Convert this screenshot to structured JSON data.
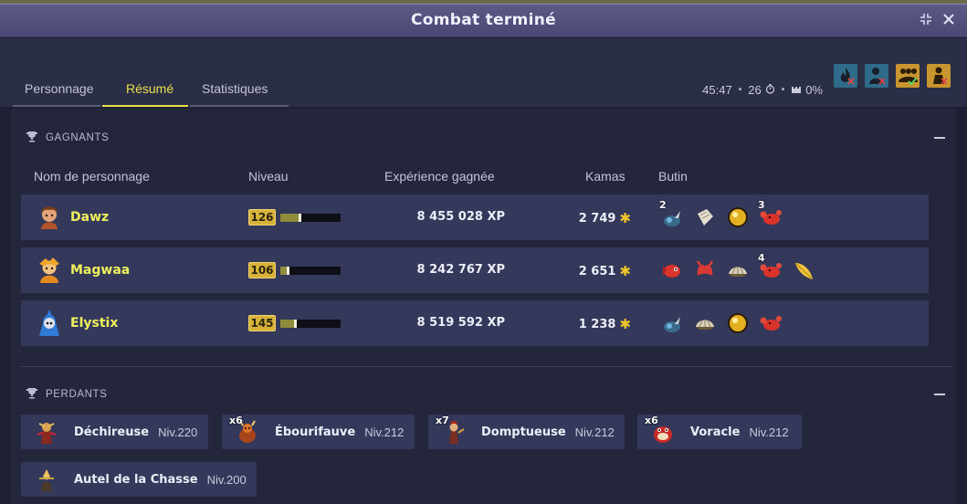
{
  "window": {
    "title": "Combat terminé",
    "restore_icon": "restore-icon",
    "close_icon": "close-icon"
  },
  "tabs": [
    {
      "label": "Personnage",
      "active": false
    },
    {
      "label": "Résumé",
      "active": true
    },
    {
      "label": "Statistiques",
      "active": false
    }
  ],
  "fight_info": {
    "duration": "45:47",
    "turns": "26",
    "separator": "•",
    "progress": "0%"
  },
  "state_icons": [
    "dark-flame-crossed-icon",
    "silhouette-crossed-icon",
    "group-checked-icon",
    "fighter-crossed-icon"
  ],
  "winners": {
    "title": "GAGNANTS",
    "columns": {
      "name": "Nom de personnage",
      "level": "Niveau",
      "xp": "Expérience gagnée",
      "kamas": "Kamas",
      "loot": "Butin"
    },
    "rows": [
      {
        "name": "Dawz",
        "level": "126",
        "level_progress": 0.3,
        "xp": "8 455 028 XP",
        "kamas": "2 749",
        "loot": [
          {
            "icon": "bird-tonic-icon",
            "qty": "2"
          },
          {
            "icon": "parchment-icon",
            "qty": ""
          },
          {
            "icon": "gold-orb-icon",
            "qty": ""
          },
          {
            "icon": "red-crab-icon",
            "qty": "3"
          }
        ]
      },
      {
        "name": "Magwaa",
        "level": "106",
        "level_progress": 0.1,
        "xp": "8 242 767 XP",
        "kamas": "2 651",
        "loot": [
          {
            "icon": "red-fish-icon",
            "qty": ""
          },
          {
            "icon": "red-claw-icon",
            "qty": ""
          },
          {
            "icon": "shell-icon",
            "qty": ""
          },
          {
            "icon": "red-crab-icon",
            "qty": "4"
          },
          {
            "icon": "feather-icon",
            "qty": ""
          }
        ]
      },
      {
        "name": "Elystix",
        "level": "145",
        "level_progress": 0.22,
        "xp": "8 519 592 XP",
        "kamas": "1 238",
        "loot": [
          {
            "icon": "bird-tonic-icon",
            "qty": ""
          },
          {
            "icon": "shell-icon",
            "qty": ""
          },
          {
            "icon": "gold-orb-icon",
            "qty": ""
          },
          {
            "icon": "red-crab-icon",
            "qty": ""
          }
        ]
      }
    ]
  },
  "losers": {
    "title": "PERDANTS",
    "items": [
      {
        "name": "Déchireuse",
        "level": "Niv.220",
        "qty": ""
      },
      {
        "name": "Ébourifauve",
        "level": "Niv.212",
        "qty": "x6"
      },
      {
        "name": "Domptueuse",
        "level": "Niv.212",
        "qty": "x7"
      },
      {
        "name": "Voracle",
        "level": "Niv.212",
        "qty": "x6"
      },
      {
        "name": "Autel de la Chasse",
        "level": "Niv.200",
        "qty": ""
      }
    ]
  },
  "colors": {
    "accent": "#e8e24a",
    "name_yellow": "#eef05c",
    "level_badge": "#d7b23a",
    "kama_gold": "#f0c42c",
    "row_bg": "#34385a"
  }
}
